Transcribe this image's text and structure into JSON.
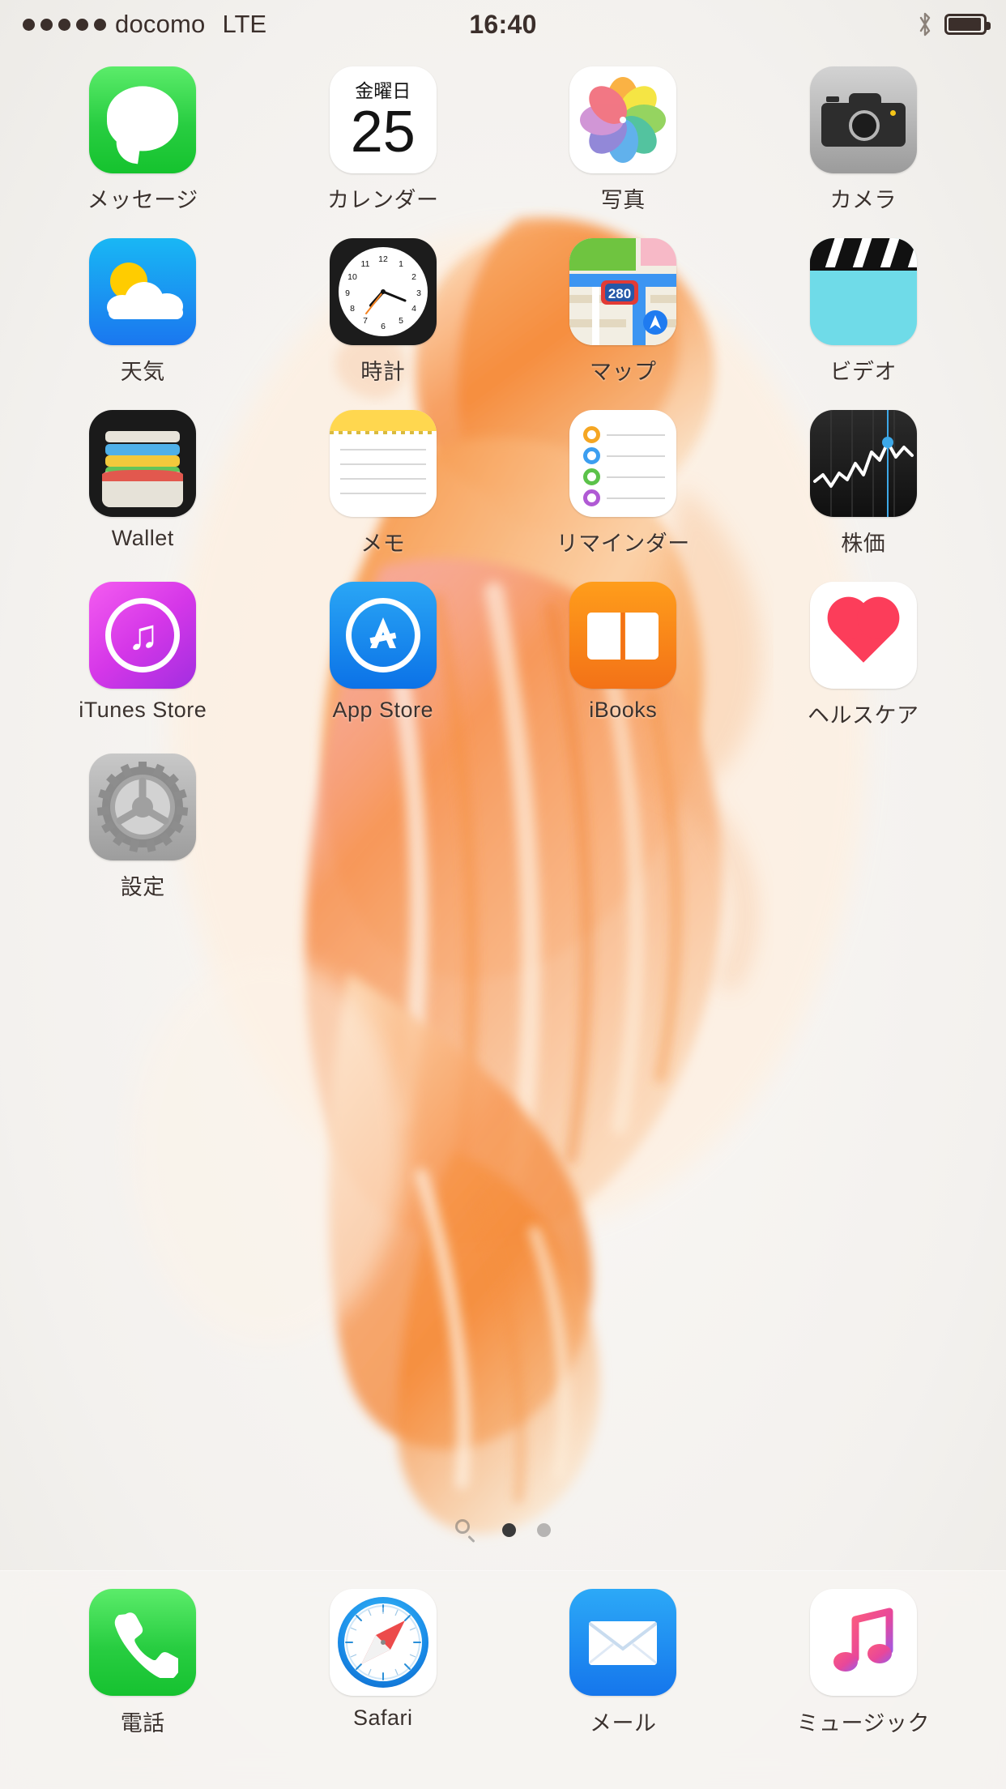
{
  "status_bar": {
    "signal_dots_filled": 5,
    "signal_dots_total": 5,
    "carrier": "docomo",
    "network_type": "LTE",
    "time": "16:40",
    "bluetooth_icon": "bluetooth-icon",
    "battery_icon": "battery-icon",
    "battery_level_pct": 92
  },
  "home": {
    "wallpaper_name": "betta-fish-orange",
    "rows": [
      [
        {
          "label": "メッセージ",
          "icon": "messages-icon",
          "name": "messages"
        },
        {
          "label": "カレンダー",
          "icon": "calendar-icon",
          "name": "calendar",
          "day_of_week": "金曜日",
          "day_number": "25"
        },
        {
          "label": "写真",
          "icon": "photos-icon",
          "name": "photos"
        },
        {
          "label": "カメラ",
          "icon": "camera-icon",
          "name": "camera"
        }
      ],
      [
        {
          "label": "天気",
          "icon": "weather-icon",
          "name": "weather"
        },
        {
          "label": "時計",
          "icon": "clock-icon",
          "name": "clock"
        },
        {
          "label": "マップ",
          "icon": "maps-icon",
          "name": "maps",
          "badge_text": "280"
        },
        {
          "label": "ビデオ",
          "icon": "videos-icon",
          "name": "videos"
        }
      ],
      [
        {
          "label": "Wallet",
          "icon": "wallet-icon",
          "name": "wallet"
        },
        {
          "label": "メモ",
          "icon": "notes-icon",
          "name": "notes"
        },
        {
          "label": "リマインダー",
          "icon": "reminders-icon",
          "name": "reminders"
        },
        {
          "label": "株価",
          "icon": "stocks-icon",
          "name": "stocks"
        }
      ],
      [
        {
          "label": "iTunes Store",
          "icon": "itunes-store-icon",
          "name": "itunes-store"
        },
        {
          "label": "App Store",
          "icon": "app-store-icon",
          "name": "app-store"
        },
        {
          "label": "iBooks",
          "icon": "ibooks-icon",
          "name": "ibooks"
        },
        {
          "label": "ヘルスケア",
          "icon": "health-icon",
          "name": "health"
        }
      ],
      [
        {
          "label": "設定",
          "icon": "settings-icon",
          "name": "settings"
        }
      ]
    ]
  },
  "page_indicator": {
    "search_icon": "search-icon",
    "total_pages": 2,
    "active_page": 1
  },
  "dock": {
    "apps": [
      {
        "label": "電話",
        "icon": "phone-icon",
        "name": "phone"
      },
      {
        "label": "Safari",
        "icon": "safari-icon",
        "name": "safari"
      },
      {
        "label": "メール",
        "icon": "mail-icon",
        "name": "mail"
      },
      {
        "label": "ミュージック",
        "icon": "music-icon",
        "name": "music"
      }
    ]
  },
  "colors": {
    "messages_green": "#28cd41",
    "weather_blue": "#1a77ef",
    "camera_gray": "#b9b9b9",
    "itunes_magenta": "#d537e8",
    "appstore_blue": "#0b72e7",
    "ibooks_orange": "#f37217",
    "health_red": "#fc3d5a",
    "wallpaper_orange": "#f08a3c",
    "label_text": "#3b322e"
  }
}
